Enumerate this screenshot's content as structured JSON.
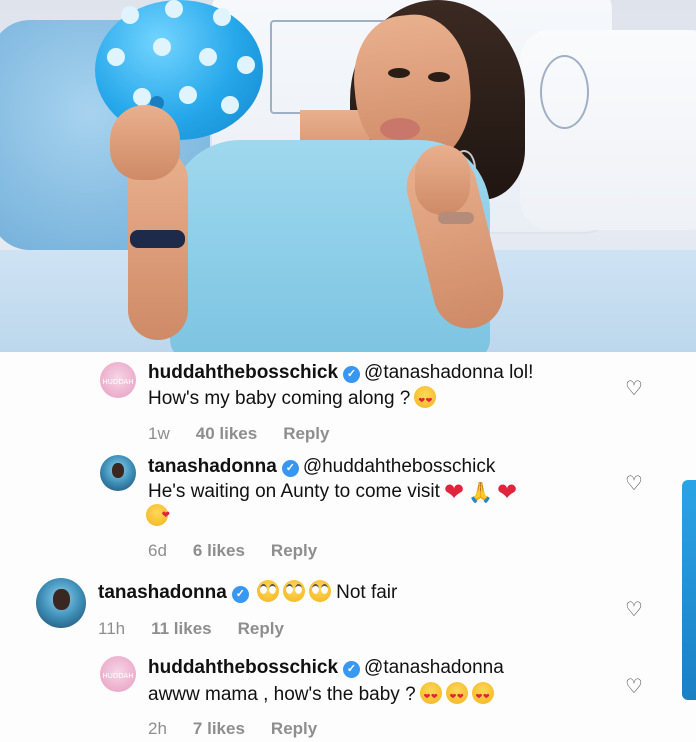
{
  "comments": [
    {
      "username": "huddahthebosschick",
      "mention": "@tanashadonna",
      "text_line1": "lol!",
      "text_line2": "How's my baby coming along ?",
      "time": "1w",
      "likes": "40 likes",
      "reply": "Reply",
      "avatar_text": "HUDDAH",
      "emojis": [
        "smiling-face-with-heart-eyes"
      ]
    },
    {
      "username": "tanashadonna",
      "mention": "@huddahthebosschick",
      "text_line1": "He's waiting on Aunty to come visit",
      "time": "6d",
      "likes": "6 likes",
      "reply": "Reply",
      "emojis": [
        "red-heart",
        "folded-hands",
        "red-heart",
        "face-blowing-a-kiss"
      ]
    },
    {
      "username": "tanashadonna",
      "text": "Not fair",
      "time": "11h",
      "likes": "11 likes",
      "reply": "Reply",
      "emojis": [
        "face-with-rolling-eyes",
        "face-with-rolling-eyes",
        "face-with-rolling-eyes"
      ]
    },
    {
      "username": "huddahthebosschick",
      "mention": "@tanashadonna",
      "text_line1": "awww mama , how's the baby ?",
      "time": "2h",
      "likes": "7 likes",
      "reply": "Reply",
      "avatar_text": "HUDDAH",
      "emojis": [
        "smiling-face-with-heart-eyes",
        "smiling-face-with-heart-eyes",
        "smiling-face-with-heart-eyes"
      ]
    }
  ],
  "colors": {
    "verified": "#3897f0",
    "meta": "#8e8e8e",
    "heart_emoji": "#e0243c"
  },
  "icons": {
    "verified": "verified-badge-icon",
    "like": "heart-outline-icon"
  }
}
